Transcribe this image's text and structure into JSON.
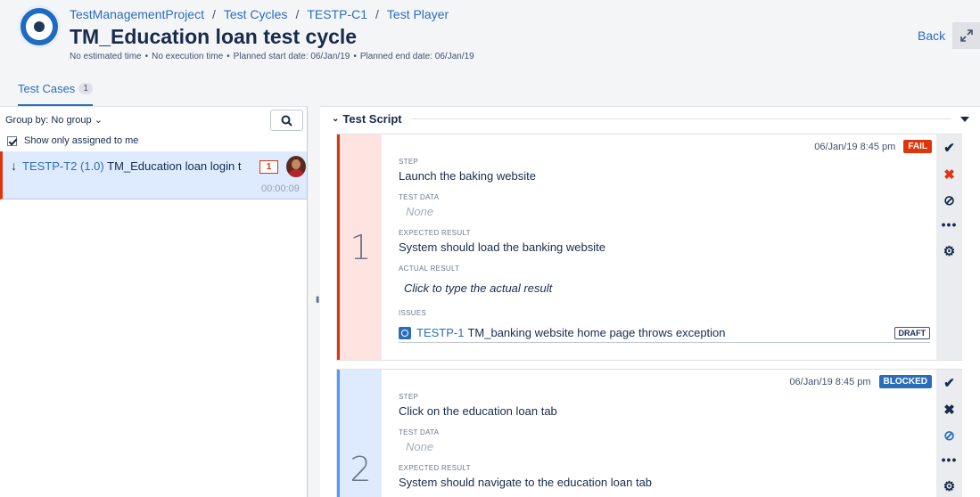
{
  "breadcrumb": [
    "TestManagementProject",
    "Test Cycles",
    "TESTP-C1",
    "Test Player"
  ],
  "title": "TM_Education loan test cycle",
  "meta": [
    "No estimated time",
    "No execution time",
    "Planned start date: 06/Jan/19",
    "Planned end date: 06/Jan/19"
  ],
  "back_label": "Back",
  "tabs": [
    {
      "label": "Test Cases",
      "count": "1"
    }
  ],
  "left_panel": {
    "group_by": "Group by: No group",
    "show_assigned": "Show only assigned to me",
    "show_assigned_checked": true,
    "test_case": {
      "key": "TESTP-T2 (1.0)",
      "name": "TM_Education loan login t",
      "defects": "1",
      "time": "00:00:09"
    }
  },
  "test_script": {
    "header": "Test Script",
    "steps": [
      {
        "number": "1",
        "status_date": "06/Jan/19 8:45 pm",
        "status": "FAIL",
        "step_label": "STEP",
        "step": "Launch the baking website",
        "test_data_label": "TEST DATA",
        "test_data": "None",
        "expected_label": "EXPECTED RESULT",
        "expected": "System should load the banking website",
        "actual_label": "ACTUAL RESULT",
        "actual": "Click to type the actual result",
        "issues_label": "ISSUES",
        "issue_key": "TESTP-1",
        "issue_summary": "TM_banking website home page throws exception",
        "issue_status": "DRAFT"
      },
      {
        "number": "2",
        "status_date": "06/Jan/19 8:45 pm",
        "status": "BLOCKED",
        "step_label": "STEP",
        "step": "Click on the education loan tab",
        "test_data_label": "TEST DATA",
        "test_data": "None",
        "expected_label": "EXPECTED RESULT",
        "expected": "System should navigate to the education loan tab"
      }
    ]
  },
  "colors": {
    "accent": "#2a6ebb",
    "fail": "#de350b",
    "blocked": "#2a6ebb"
  }
}
